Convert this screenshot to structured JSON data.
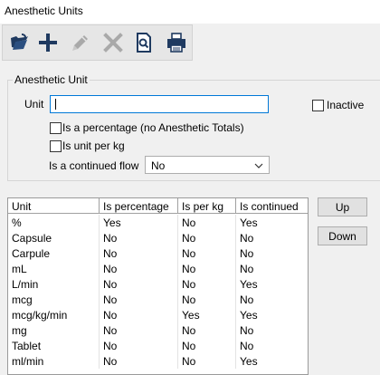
{
  "window": {
    "title": "Anesthetic Units"
  },
  "toolbar": {
    "buttons": [
      {
        "icon": "open-folder-icon",
        "enabled": true
      },
      {
        "icon": "plus-icon",
        "enabled": true
      },
      {
        "icon": "pencil-icon",
        "enabled": false
      },
      {
        "icon": "x-delete-icon",
        "enabled": false
      },
      {
        "icon": "print-preview-icon",
        "enabled": true
      },
      {
        "icon": "printer-icon",
        "enabled": true
      }
    ]
  },
  "form": {
    "group_label": "Anesthetic Unit",
    "unit_label": "Unit",
    "unit_value": "",
    "inactive_label": "Inactive",
    "inactive_checked": false,
    "is_percentage_label": "Is a percentage (no Anesthetic Totals)",
    "is_percentage_checked": false,
    "is_per_kg_label": "Is unit per kg",
    "is_per_kg_checked": false,
    "continued_flow_label": "Is a continued flow",
    "continued_flow_value": "No"
  },
  "grid": {
    "columns": [
      "Unit",
      "Is percentage",
      "Is per kg",
      "Is continued"
    ],
    "rows": [
      [
        "%",
        "Yes",
        "No",
        "Yes"
      ],
      [
        "Capsule",
        "No",
        "No",
        "No"
      ],
      [
        "Carpule",
        "No",
        "No",
        "No"
      ],
      [
        "mL",
        "No",
        "No",
        "No"
      ],
      [
        "L/min",
        "No",
        "No",
        "Yes"
      ],
      [
        "mcg",
        "No",
        "No",
        "No"
      ],
      [
        "mcg/kg/min",
        "No",
        "Yes",
        "Yes"
      ],
      [
        "mg",
        "No",
        "No",
        "No"
      ],
      [
        "Tablet",
        "No",
        "No",
        "No"
      ],
      [
        "ml/min",
        "No",
        "No",
        "Yes"
      ]
    ]
  },
  "side_buttons": {
    "up_label": "Up",
    "down_label": "Down"
  },
  "colors": {
    "accent": "#0078d7",
    "toolbar_bg": "#e6e6e6",
    "window_bg": "#f0f0f0"
  }
}
